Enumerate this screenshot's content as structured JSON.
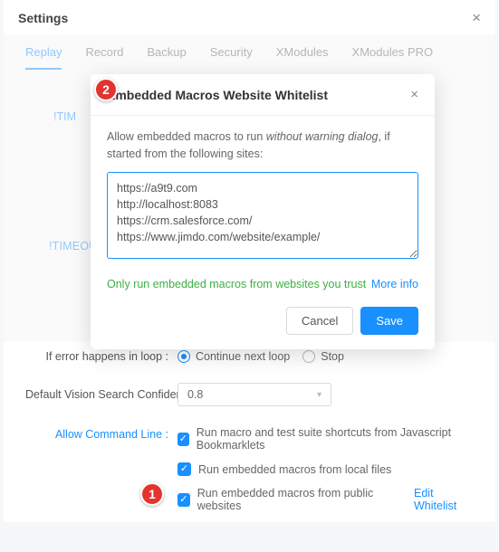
{
  "header": {
    "title": "Settings"
  },
  "tabs": [
    {
      "label": "Replay",
      "active": true
    },
    {
      "label": "Record"
    },
    {
      "label": "Backup"
    },
    {
      "label": "Security"
    },
    {
      "label": "XModules"
    },
    {
      "label": "XModules PRO"
    }
  ],
  "partial_labels": {
    "row_a": "!TIM",
    "row_b": "!TIMEOUT_DOWNLOAD :"
  },
  "loop": {
    "label": "If error happens in loop :",
    "opt_continue": "Continue next loop",
    "opt_stop": "Stop",
    "selected": "continue"
  },
  "vision": {
    "label": "Default Vision Search Confidence :",
    "value": "0.8"
  },
  "cmdline": {
    "label": "Allow Command Line :",
    "cb1": "Run macro and test suite shortcuts from Javascript Bookmarklets",
    "cb2": "Run embedded macros from local files",
    "cb3": "Run embedded macros from public websites",
    "edit": "Edit Whitelist"
  },
  "badges": {
    "one": "1",
    "two": "2"
  },
  "modal": {
    "title": "Embedded Macros Website Whitelist",
    "desc_pre": "Allow embedded macros to run ",
    "desc_em": "without warning dialog",
    "desc_post": ", if started from the following sites:",
    "textarea": "https://a9t9.com\nhttp://localhost:8083\nhttps://crm.salesforce.com/\nhttps://www.jimdo.com/website/example/",
    "trust": "Only run embedded macros from websites you trust",
    "more": "More info",
    "cancel": "Cancel",
    "save": "Save"
  }
}
